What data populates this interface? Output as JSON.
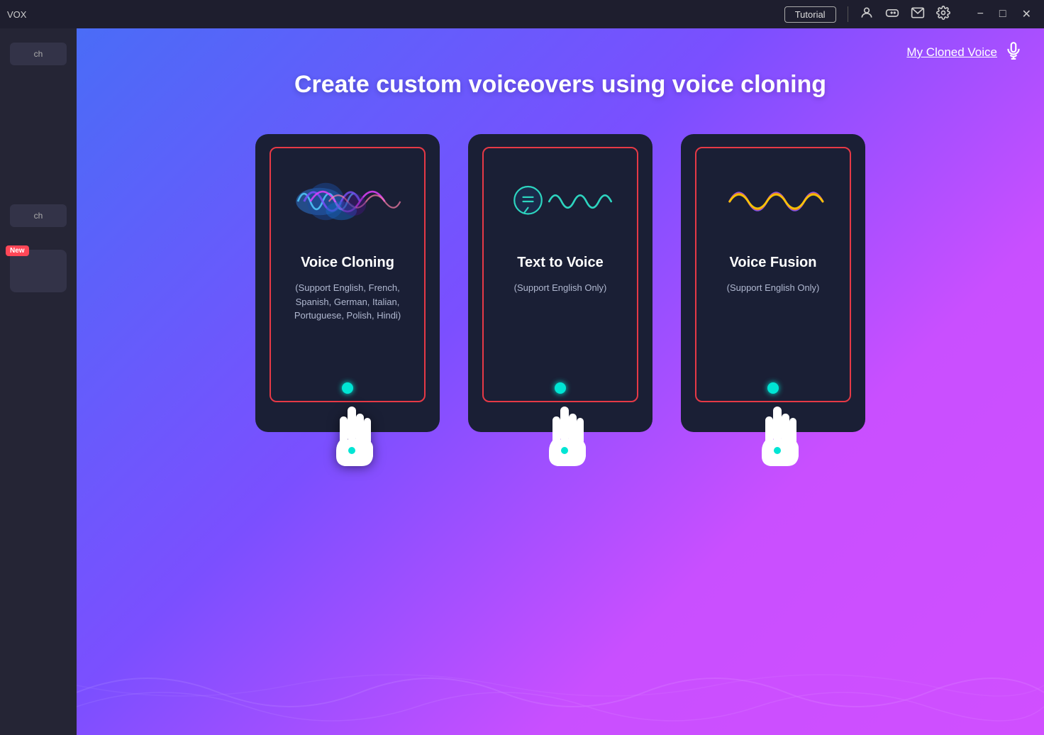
{
  "titleBar": {
    "appName": "VOX",
    "tutorialLabel": "Tutorial",
    "icons": [
      "user",
      "game",
      "mail",
      "settings"
    ],
    "windowControls": [
      "minimize",
      "maximize",
      "close"
    ]
  },
  "sidebar": {
    "searchLabel": "ch",
    "searchLabel2": "ch",
    "newBadge": "New"
  },
  "header": {
    "myClonedVoiceLabel": "My Cloned Voice"
  },
  "main": {
    "heading": "Create custom voiceovers using voice cloning",
    "cards": [
      {
        "id": "voice-cloning",
        "title": "Voice Cloning",
        "description": "(Support English, French, Spanish, German, Italian, Portuguese, Polish, Hindi)"
      },
      {
        "id": "text-to-voice",
        "title": "Text to Voice",
        "description": "(Support English Only)"
      },
      {
        "id": "voice-fusion",
        "title": "Voice Fusion",
        "description": "(Support English Only)"
      }
    ]
  }
}
